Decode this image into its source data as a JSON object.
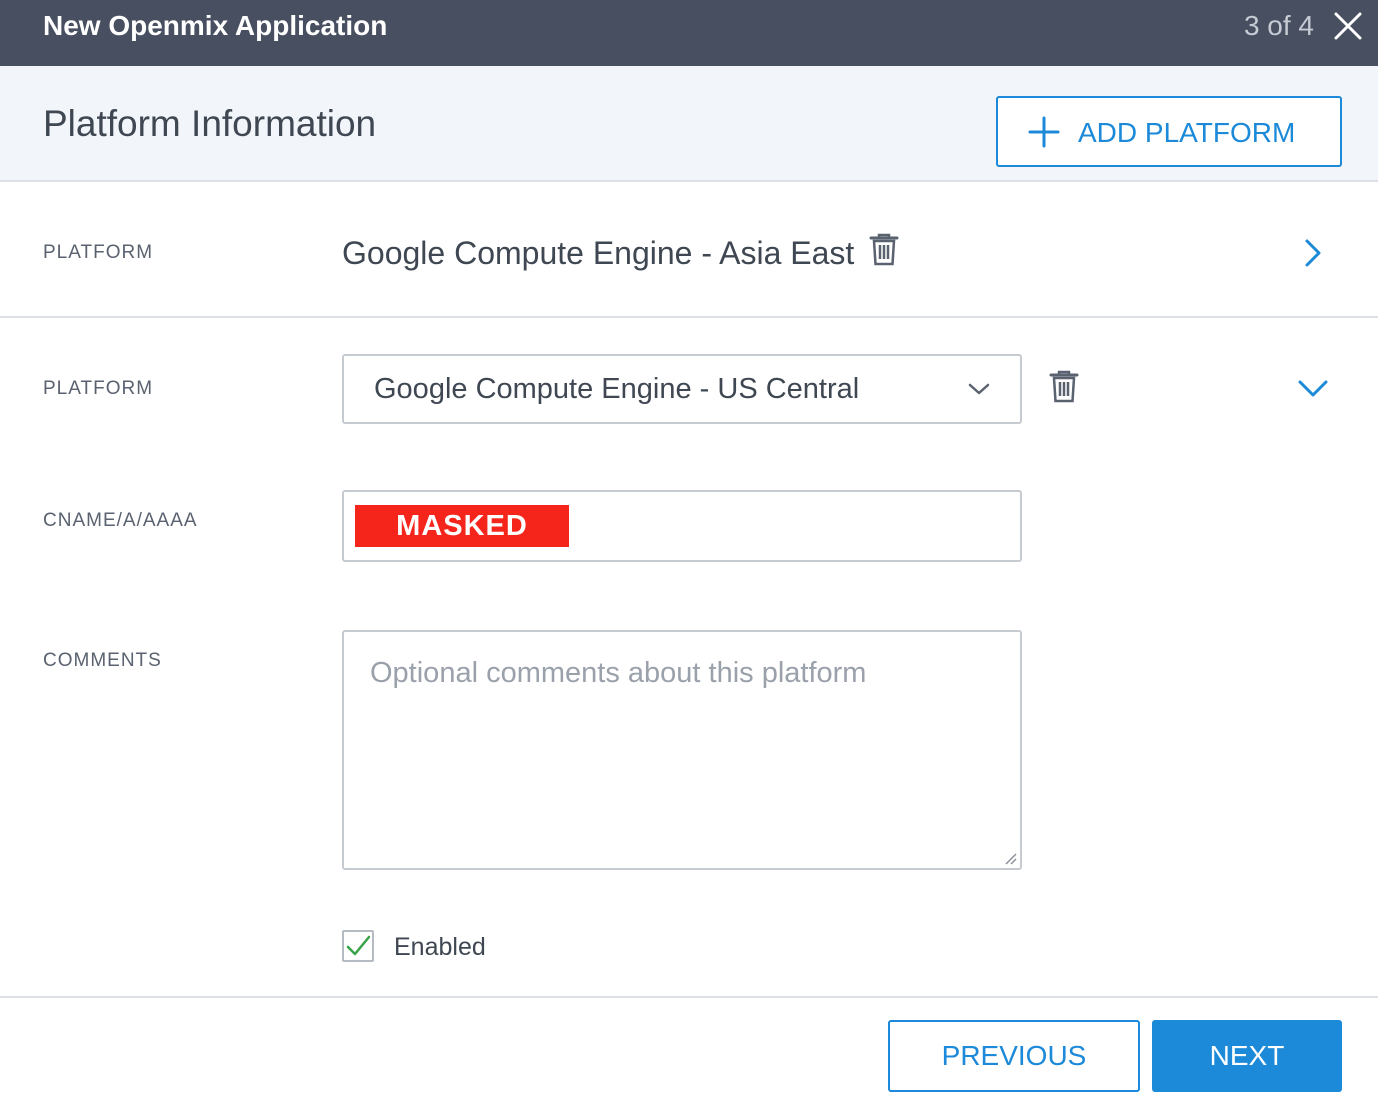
{
  "window": {
    "title": "New Openmix Application",
    "step": "3 of 4",
    "close_icon": "close-icon"
  },
  "section": {
    "title": "Platform Information",
    "add_button_label": "ADD PLATFORM",
    "add_icon": "plus-icon"
  },
  "platforms": [
    {
      "label": "PLATFORM",
      "value": "Google Compute Engine - Asia East",
      "state": "collapsed",
      "delete_icon": "trash-icon",
      "toggle_icon": "chevron-right-icon"
    },
    {
      "label": "PLATFORM",
      "value": "Google Compute Engine - US Central",
      "state": "expanded",
      "delete_icon": "trash-icon",
      "toggle_icon": "chevron-down-icon",
      "cname_label": "CNAME/A/AAAA",
      "cname_value": "MASKED",
      "comments_label": "COMMENTS",
      "comments_placeholder": "Optional comments about this platform",
      "enabled_label": "Enabled",
      "enabled": true
    }
  ],
  "footer": {
    "previous_label": "PREVIOUS",
    "next_label": "NEXT"
  },
  "colors": {
    "titlebar": "#474f60",
    "accent": "#1c8ad8",
    "masked": "#f6251c",
    "check": "#3aa34a"
  }
}
